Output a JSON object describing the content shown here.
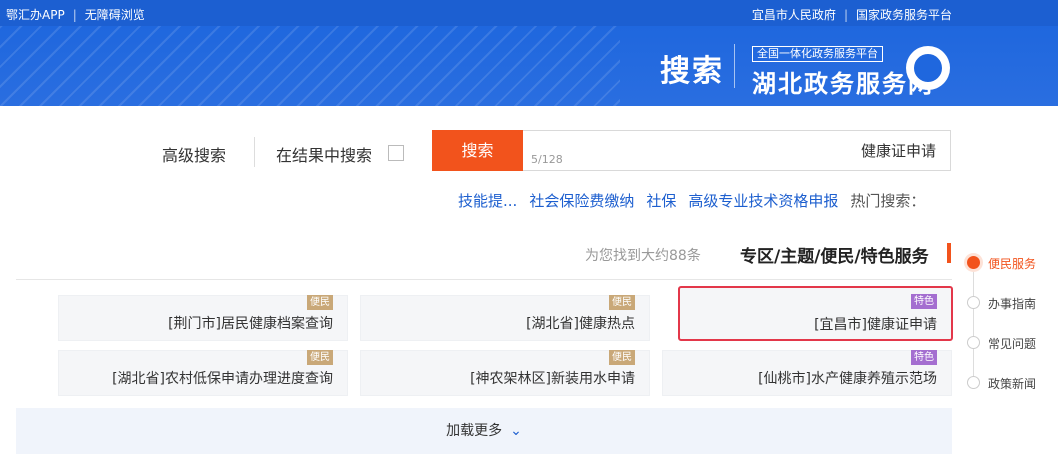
{
  "topbar": {
    "left": [
      "鄂汇办APP",
      "无障碍浏览"
    ],
    "right": [
      "宜昌市人民政府",
      "国家政务服务平台"
    ]
  },
  "header": {
    "search_title": "搜索",
    "site_subtitle": "全国一体化政务服务平台",
    "site_name": "湖北政务服务网"
  },
  "search": {
    "advanced_label": "高级搜索",
    "in_results_label": "在结果中搜索",
    "button_label": "搜索",
    "query": "健康证申请",
    "counter": "5/128"
  },
  "hot": {
    "label": "热门搜索：",
    "items": [
      "高级专业技术资格申报",
      "社保",
      "社会保险费缴纳",
      "技能提..."
    ]
  },
  "section": {
    "title": "专区/主题/便民/特色服务",
    "count": "为您找到大约88条"
  },
  "cards": [
    {
      "tag": "特色",
      "text": "[宜昌市]健康证申请"
    },
    {
      "tag": "便民",
      "text": "[湖北省]健康热点"
    },
    {
      "tag": "便民",
      "text": "[荆门市]居民健康档案查询"
    },
    {
      "tag": "特色",
      "text": "[仙桃市]水产健康养殖示范场"
    },
    {
      "tag": "便民",
      "text": "[神农架林区]新装用水申请"
    },
    {
      "tag": "便民",
      "text": "[湖北省]农村低保申请办理进度查询"
    }
  ],
  "load_more": "加载更多",
  "rnav": [
    "便民服务",
    "办事指南",
    "常见问题",
    "政策新闻"
  ],
  "colors": {
    "accent": "#f2531c",
    "brand": "#1c5fd1",
    "link": "#1d5fcf",
    "highlight": "#e3374a"
  }
}
